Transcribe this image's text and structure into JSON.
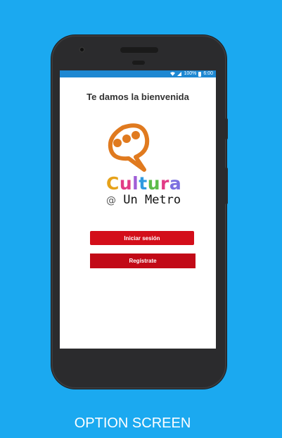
{
  "status_bar": {
    "battery": "100%",
    "time": "6:00"
  },
  "screen": {
    "welcome": "Te damos la bienvenida",
    "logo": {
      "brand_letters": [
        "C",
        "u",
        "l",
        "t",
        "u",
        "r",
        "a"
      ],
      "brand_colors": [
        "#e6a21a",
        "#e23b86",
        "#a05ed6",
        "#2e9ae0",
        "#5cbd4a",
        "#e23b86",
        "#7b6fe0"
      ],
      "at_symbol": "@",
      "subtitle": "Un Metro"
    },
    "login_label": "Iniciar sesión",
    "register_label": "Regístrate"
  },
  "caption": "OPTION SCREEN",
  "colors": {
    "background": "#1ba9f0",
    "status_bar": "#1e88d2",
    "primary_button": "#d30e1a",
    "secondary_button": "#c20a17"
  }
}
